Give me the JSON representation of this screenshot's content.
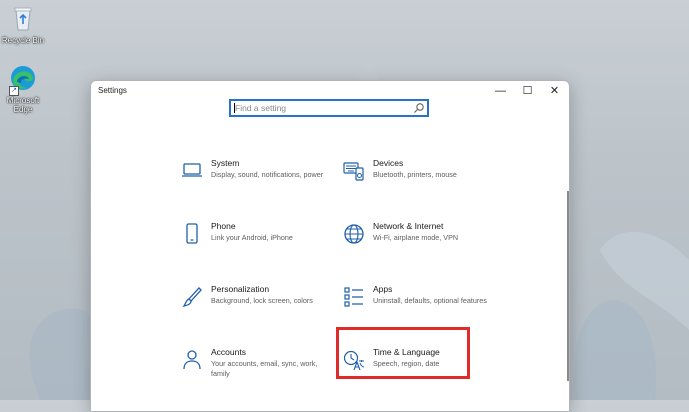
{
  "desktop": {
    "icons": [
      {
        "label": "Recycle Bin",
        "icon": "recycle-bin-icon"
      },
      {
        "label": "Microsoft Edge",
        "icon": "edge-icon"
      }
    ]
  },
  "window": {
    "title": "Settings",
    "controls": {
      "minimize": "—",
      "maximize": "☐",
      "close": "✕"
    }
  },
  "search": {
    "placeholder": "Find a setting"
  },
  "categories": [
    {
      "name": "System",
      "desc": "Display, sound, notifications, power",
      "icon": "laptop-icon"
    },
    {
      "name": "Devices",
      "desc": "Bluetooth, printers, mouse",
      "icon": "keyboard-speaker-icon"
    },
    {
      "name": "Phone",
      "desc": "Link your Android, iPhone",
      "icon": "phone-icon"
    },
    {
      "name": "Network & Internet",
      "desc": "Wi-Fi, airplane mode, VPN",
      "icon": "globe-icon"
    },
    {
      "name": "Personalization",
      "desc": "Background, lock screen, colors",
      "icon": "paintbrush-icon"
    },
    {
      "name": "Apps",
      "desc": "Uninstall, defaults, optional features",
      "icon": "apps-list-icon"
    },
    {
      "name": "Accounts",
      "desc": "Your accounts, email, sync, work, family",
      "icon": "person-icon"
    },
    {
      "name": "Time & Language",
      "desc": "Speech, region, date",
      "icon": "time-language-icon"
    }
  ],
  "colors": {
    "accent": "#2a72c8",
    "highlight": "#e02b2b",
    "icon": "#1f5fa8"
  }
}
